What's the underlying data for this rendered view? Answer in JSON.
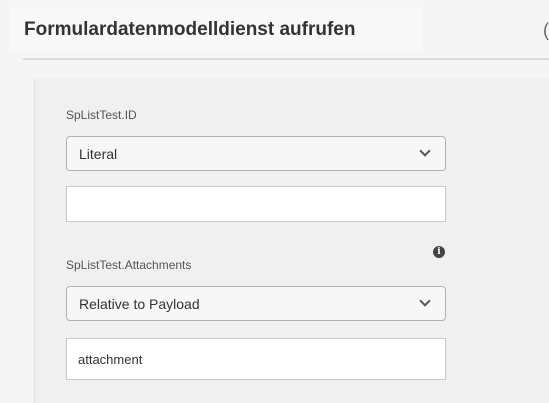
{
  "header": {
    "title": "Formulardatenmodelldienst aufrufen",
    "edge_glyph": "("
  },
  "fields": [
    {
      "label": "SpListTest.ID",
      "mode": "Literal",
      "value": ""
    },
    {
      "label": "SpListTest.Attachments",
      "mode": "Relative to Payload",
      "value": "attachment",
      "info_icon": "i"
    }
  ]
}
